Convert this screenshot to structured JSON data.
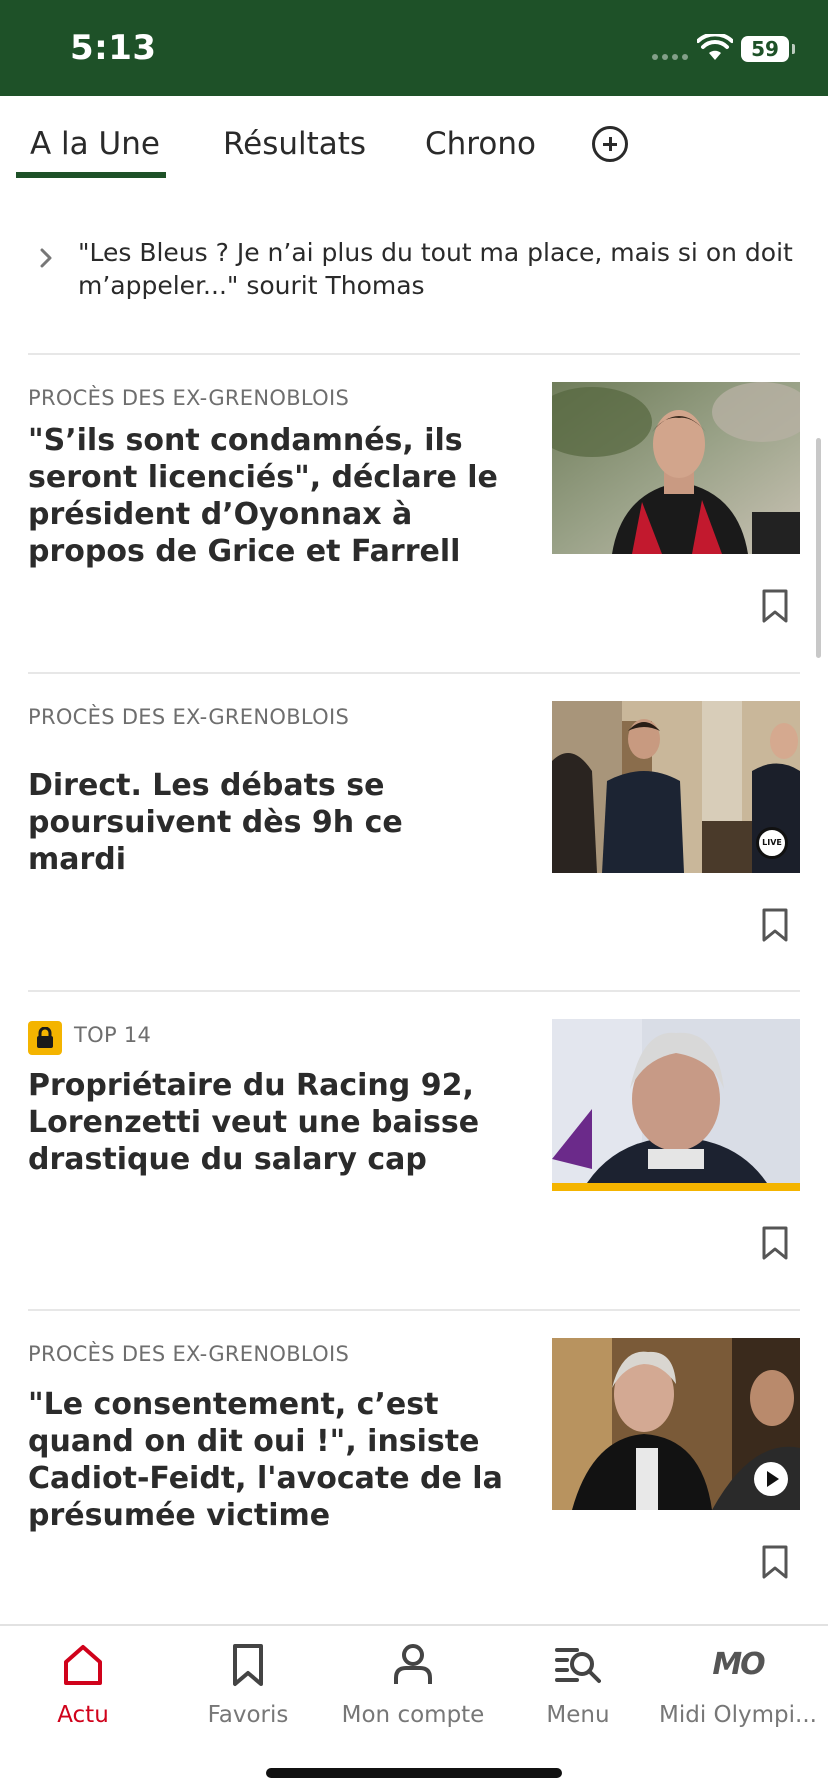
{
  "status_bar": {
    "time": "5:13",
    "battery": "59",
    "icons": [
      "signal-icon",
      "wifi-icon",
      "battery-icon"
    ]
  },
  "tabs": [
    {
      "label": "A la Une",
      "active": true
    },
    {
      "label": "Résultats",
      "active": false
    },
    {
      "label": "Chrono",
      "active": false
    }
  ],
  "add_tab_icon": "plus-circle-icon",
  "related": {
    "text": "\"Les Bleus ? Je n’ai plus du tout ma place, mais si on doit m’appeler...\" sourit Thomas",
    "icon": "chevron-right-icon"
  },
  "articles": [
    {
      "category": "PROCÈS DES EX-GRENOBLOIS",
      "title": "\"S’ils sont condamnés, ils seront licenciés\", déclare le président d’Oyonnax à propos de Grice et Farrell",
      "premium": false,
      "badge": ""
    },
    {
      "category": "PROCÈS DES EX-GRENOBLOIS",
      "title": "Direct. Les débats se poursuivent dès 9h ce mardi",
      "premium": false,
      "badge": "LIVE"
    },
    {
      "category": "TOP 14",
      "title": "Propriétaire du Racing 92, Lorenzetti veut une baisse drastique du salary cap",
      "premium": true,
      "badge": ""
    },
    {
      "category": "PROCÈS DES EX-GRENOBLOIS",
      "title": "\"Le consentement, c’est quand on dit oui !\", insiste Cadiot-Feidt, l'avocate de la présumée victime",
      "premium": false,
      "badge": "play"
    }
  ],
  "bottom_nav": [
    {
      "label": "Actu",
      "icon": "home-icon",
      "active": true
    },
    {
      "label": "Favoris",
      "icon": "bookmark-icon",
      "active": false
    },
    {
      "label": "Mon compte",
      "icon": "user-icon",
      "active": false
    },
    {
      "label": "Menu",
      "icon": "menu-search-icon",
      "active": false
    },
    {
      "label": "Midi Olympi...",
      "icon": "mo-logo",
      "logo_text": "MO",
      "active": false
    }
  ],
  "colors": {
    "brand_green": "#1e5128",
    "accent_red": "#d0021b",
    "premium_yellow": "#f4b400"
  }
}
